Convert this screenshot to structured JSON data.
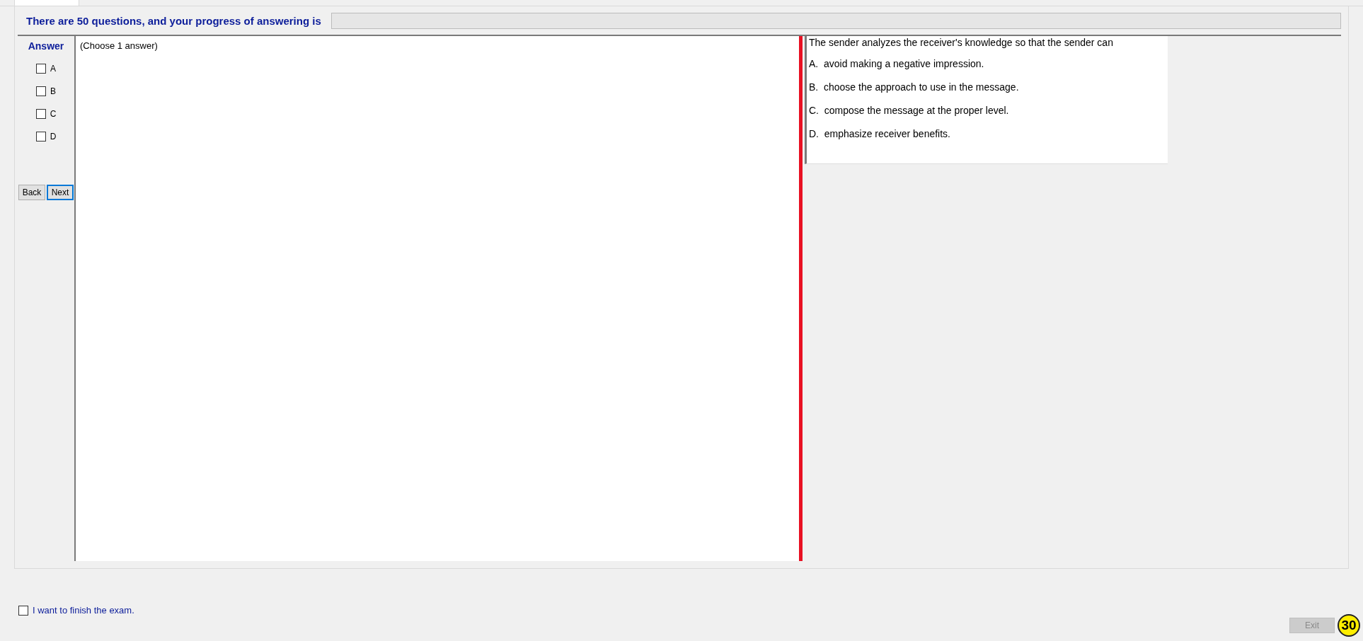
{
  "header": {
    "text": "There are 50 questions, and your progress of answering is",
    "progress": {
      "level": 0
    }
  },
  "answer_panel": {
    "title": "Answer",
    "options": [
      {
        "label": "A",
        "checked": false
      },
      {
        "label": "B",
        "checked": false
      },
      {
        "label": "C",
        "checked": false
      },
      {
        "label": "D",
        "checked": false
      }
    ],
    "buttons": [
      {
        "label": "Back",
        "focused": false
      },
      {
        "label": "Next",
        "focused": true
      }
    ]
  },
  "instruction": "(Choose 1 answer)",
  "question": {
    "text": "The sender analyzes the receiver's knowledge so that the sender can",
    "choices": [
      "A.  avoid making a negative impression.",
      "B.  choose the approach to use in the message.",
      "C.  compose the message at the proper level.",
      "D.  emphasize receiver benefits."
    ]
  },
  "footer": {
    "finish": {
      "label": "I want to finish the exam.",
      "checked": false
    },
    "exit": {
      "label": "Exit",
      "disabled": true
    },
    "badge": "30"
  }
}
